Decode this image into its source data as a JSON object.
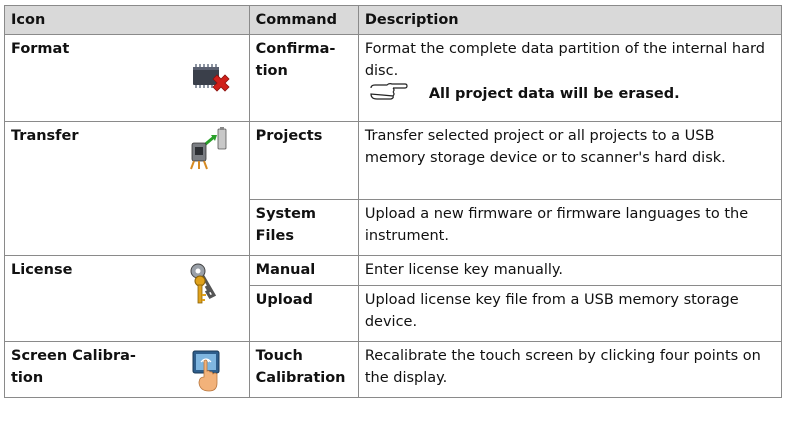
{
  "table": {
    "headers": {
      "icon": "Icon",
      "command": "Command",
      "description": "Description"
    },
    "rows": {
      "format": {
        "icon_label": "Format",
        "icon": "chip-delete-icon",
        "command": "Confirma-\ntion",
        "description": "Format the complete data partition of the internal hard disc.",
        "note_icon": "pointing-hand-icon",
        "note": "All project data will be erased."
      },
      "transfer": {
        "icon_label": "Transfer",
        "icon": "scanner-usb-transfer-icon",
        "commands": [
          {
            "command": "Projects",
            "description": "Transfer selected project or all projects to a USB memory storage device or to scanner's hard disk."
          },
          {
            "command": "System\nFiles",
            "description": "Upload a new firmware or firmware languages to the instrument."
          }
        ]
      },
      "license": {
        "icon_label": "License",
        "icon": "keys-icon",
        "commands": [
          {
            "command": "Manual",
            "description": "Enter license key manually."
          },
          {
            "command": "Upload",
            "description": "Upload license key file from a USB memory storage device."
          }
        ]
      },
      "calibration": {
        "icon_label": "Screen Calibra-\ntion",
        "icon": "touch-screen-icon",
        "command": "Touch\nCalibration",
        "description": "Recalibrate the touch screen by clicking four points on the display."
      }
    }
  }
}
